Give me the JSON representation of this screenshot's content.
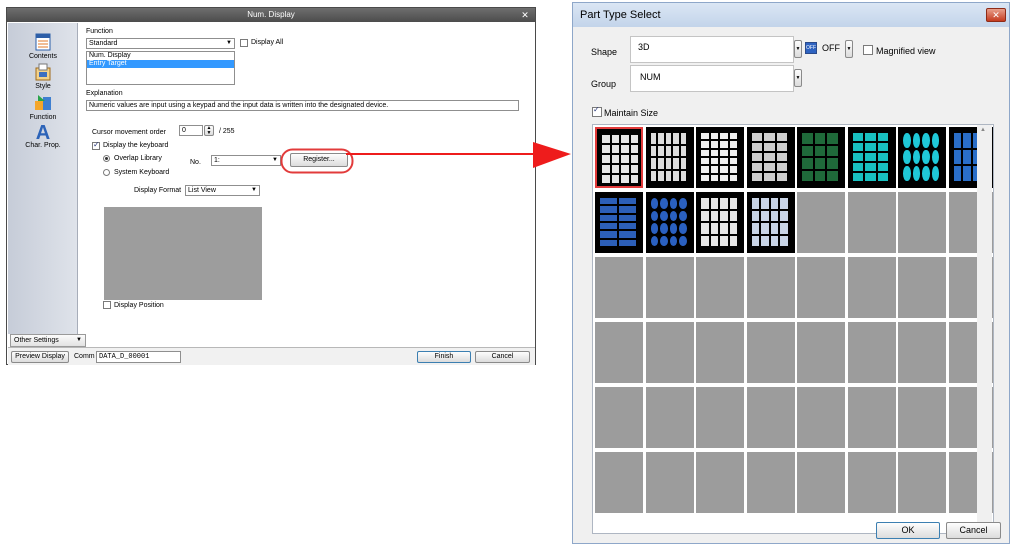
{
  "num_display": {
    "title": "Num. Display",
    "close_glyph": "✕",
    "sidebar": [
      {
        "label": "Contents",
        "icon": "contents-icon"
      },
      {
        "label": "Style",
        "icon": "style-icon"
      },
      {
        "label": "Function",
        "icon": "function-icon"
      },
      {
        "label": "Char. Prop.",
        "icon": "char-prop-icon"
      }
    ],
    "function_label": "Function",
    "function_value": "Standard",
    "display_all_label": "Display All",
    "function_list": [
      "Num. Display",
      "Entry Target"
    ],
    "explanation_label": "Explanation",
    "explanation_text": "Numeric values are input using a keypad and the input data is written into the designated device.",
    "cursor_order_label": "Cursor movement order",
    "cursor_order_value": "0",
    "cursor_order_max": "/ 255",
    "display_keyboard_label": "Display the keyboard",
    "overlap_library_label": "Overlap Library",
    "system_keyboard_label": "System Keyboard",
    "no_label": "No.",
    "no_value": "1:",
    "register_label": "Register...",
    "display_format_label": "Display Format",
    "display_format_value": "List View",
    "display_position_label": "Display Position",
    "other_settings_label": "Other Settings",
    "preview_label": "Preview Display",
    "comm_label": "Comm",
    "comm_value": "DATA_D_00001",
    "finish_label": "Finish",
    "cancel_label": "Cancel"
  },
  "part_type_select": {
    "title": "Part Type Select",
    "close_glyph": "✕",
    "shape_label": "Shape",
    "shape_value": "3D",
    "off_badge": "OFF",
    "off_text": "OFF",
    "magnified_label": "Magnified view",
    "group_label": "Group",
    "group_value": "NUM",
    "maintain_size_label": "Maintain Size",
    "ok_label": "OK",
    "cancel_label": "Cancel",
    "thumbnails_filled": 12,
    "grid_columns": 8,
    "grid_rows": 6
  },
  "colors": {
    "highlight_red": "#e23b3b",
    "selection_blue": "#3399ff",
    "arrow_red": "#ee1c1c"
  }
}
